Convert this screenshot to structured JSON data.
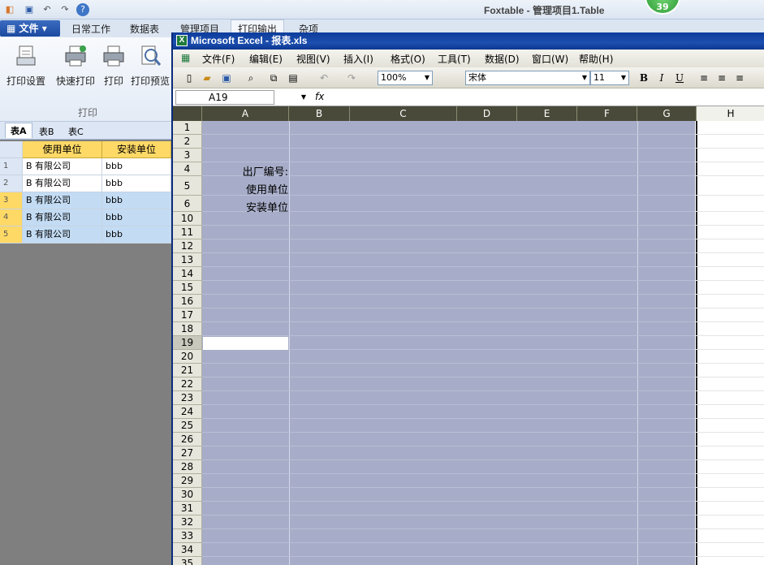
{
  "app": {
    "title": "Foxtable - 管理项目1.Table",
    "badge": "39"
  },
  "ribbon": {
    "file_label": "文件",
    "tabs": [
      "日常工作",
      "数据表",
      "管理项目",
      "打印输出",
      "杂项"
    ],
    "buttons": [
      "打印设置",
      "快速打印",
      "打印",
      "打印预览"
    ],
    "group_label": "打印"
  },
  "table_tabs": [
    "表A",
    "表B",
    "表C"
  ],
  "grid": {
    "headers": [
      "使用单位",
      "安装单位"
    ],
    "rows": [
      {
        "n": "1",
        "c1": "B 有限公司",
        "c2": "bbb"
      },
      {
        "n": "2",
        "c1": "B 有限公司",
        "c2": "bbb"
      },
      {
        "n": "3",
        "c1": "B 有限公司",
        "c2": "bbb"
      },
      {
        "n": "4",
        "c1": "B 有限公司",
        "c2": "bbb"
      },
      {
        "n": "5",
        "c1": "B 有限公司",
        "c2": "bbb"
      }
    ]
  },
  "excel": {
    "title": "Microsoft Excel - 报表.xls",
    "menu": [
      "文件(F)",
      "编辑(E)",
      "视图(V)",
      "插入(I)",
      "格式(O)",
      "工具(T)",
      "数据(D)",
      "窗口(W)",
      "帮助(H)"
    ],
    "zoom": "100%",
    "font_name": "宋体",
    "font_size": "11",
    "name_box": "A19",
    "fx": "fx",
    "columns": [
      "A",
      "B",
      "C",
      "D",
      "E",
      "F",
      "G",
      "H"
    ],
    "rows": [
      "1",
      "2",
      "3",
      "4",
      "5",
      "6",
      "10",
      "11",
      "12",
      "13",
      "14",
      "15",
      "16",
      "17",
      "18",
      "19",
      "20",
      "21",
      "22",
      "23",
      "24",
      "25",
      "26",
      "27",
      "28",
      "29",
      "30",
      "31",
      "32",
      "33",
      "34",
      "35"
    ],
    "cells": {
      "a4": "出厂编号:",
      "a5": "使用单位",
      "a6": "安装单位"
    }
  }
}
